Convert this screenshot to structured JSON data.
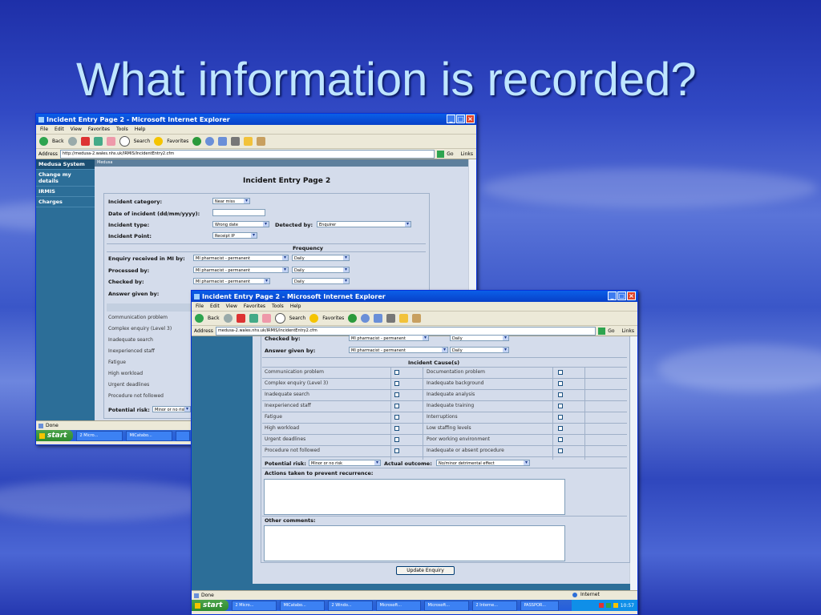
{
  "slide": {
    "title": "What information is recorded?"
  },
  "window1": {
    "title": "Incident Entry Page 2 - Microsoft Internet Explorer",
    "menu": [
      "File",
      "Edit",
      "View",
      "Favorites",
      "Tools",
      "Help"
    ],
    "toolbar": {
      "back": "Back",
      "search": "Search",
      "favorites": "Favorites"
    },
    "address_label": "Address",
    "address": "http://medusa-2.wales.nhs.uk/IRMIS/IncidentEntry2.cfm",
    "go": "Go",
    "links": "Links",
    "topstrip": "Medusa",
    "sidenav": [
      "Medusa System",
      "Change my details",
      "IRMIS",
      "Charges"
    ],
    "page_title": "Incident Entry Page 2",
    "fields": {
      "category_label": "Incident category:",
      "category_value": "Near miss",
      "date_label": "Date of incident (dd/mm/yyyy):",
      "type_label": "Incident type:",
      "type_value": "Wrong date",
      "detected_label": "Detected by:",
      "detected_value": "Enquirer",
      "point_label": "Incident Point:",
      "point_value": "Receipt IP"
    },
    "frequency_header": "Frequency",
    "rows": [
      {
        "label": "Enquiry received in MI by:",
        "person": "MI pharmacist - permanent",
        "freq": "Daily"
      },
      {
        "label": "Processed by:",
        "person": "MI pharmacist - permanent",
        "freq": "Daily"
      },
      {
        "label": "Checked by:",
        "person": "MI pharmacist - permanent",
        "freq": "Daily"
      },
      {
        "label": "Answer given by:",
        "person": "",
        "freq": ""
      }
    ],
    "causes": [
      "Communication problem",
      "Complex enquiry (Level 3)",
      "Inadequate search",
      "Inexperienced staff",
      "Fatigue",
      "High workload",
      "Urgent deadlines",
      "Procedure not followed"
    ],
    "potential_label": "Potential risk:",
    "potential_value": "Minor or no risk",
    "status": "Done",
    "taskbar": {
      "start": "start",
      "items": [
        "2 Micro...",
        "MICatabo...",
        ""
      ]
    }
  },
  "window2": {
    "title": "Incident Entry Page 2 - Microsoft Internet Explorer",
    "menu": [
      "File",
      "Edit",
      "View",
      "Favorites",
      "Tools",
      "Help"
    ],
    "toolbar": {
      "back": "Back",
      "search": "Search",
      "favorites": "Favorites"
    },
    "address_label": "Address",
    "address": "medusa-2.wales.nhs.uk/IRMIS/IncidentEntry2.cfm",
    "go": "Go",
    "links": "Links",
    "checked_label": "Checked by:",
    "checked_person": "MI pharmacist - permanent",
    "checked_freq": "Daily",
    "answer_label": "Answer given by:",
    "answer_person": "MI pharmacist - permanent",
    "answer_freq": "Daily",
    "cause_header": "Incident Cause(s)",
    "causes_left": [
      "Communication problem",
      "Complex enquiry (Level 3)",
      "Inadequate search",
      "Inexperienced staff",
      "Fatigue",
      "High workload",
      "Urgent deadlines",
      "Procedure not followed"
    ],
    "causes_right": [
      "Documentation problem",
      "Inadequate background",
      "Inadequate analysis",
      "Inadequate training",
      "Interruptions",
      "Low staffing levels",
      "Poor working environment",
      "Inadequate or absent procedure"
    ],
    "potential_label": "Potential risk:",
    "potential_value": "Minor or no risk",
    "outcome_label": "Actual outcome:",
    "outcome_value": "No/minor detrimental effect",
    "actions_label": "Actions taken to prevent recurrence:",
    "comments_label": "Other comments:",
    "update_button": "Update Enquiry",
    "status": "Done",
    "status_zone": "Internet",
    "taskbar": {
      "start": "start",
      "items": [
        "2 Micro...",
        "MICatabo...",
        "2 Windo...",
        "Microsoft...",
        "Microsoft...",
        "2 Interne...",
        "PASSPOR..."
      ],
      "clock": "10:57"
    }
  }
}
